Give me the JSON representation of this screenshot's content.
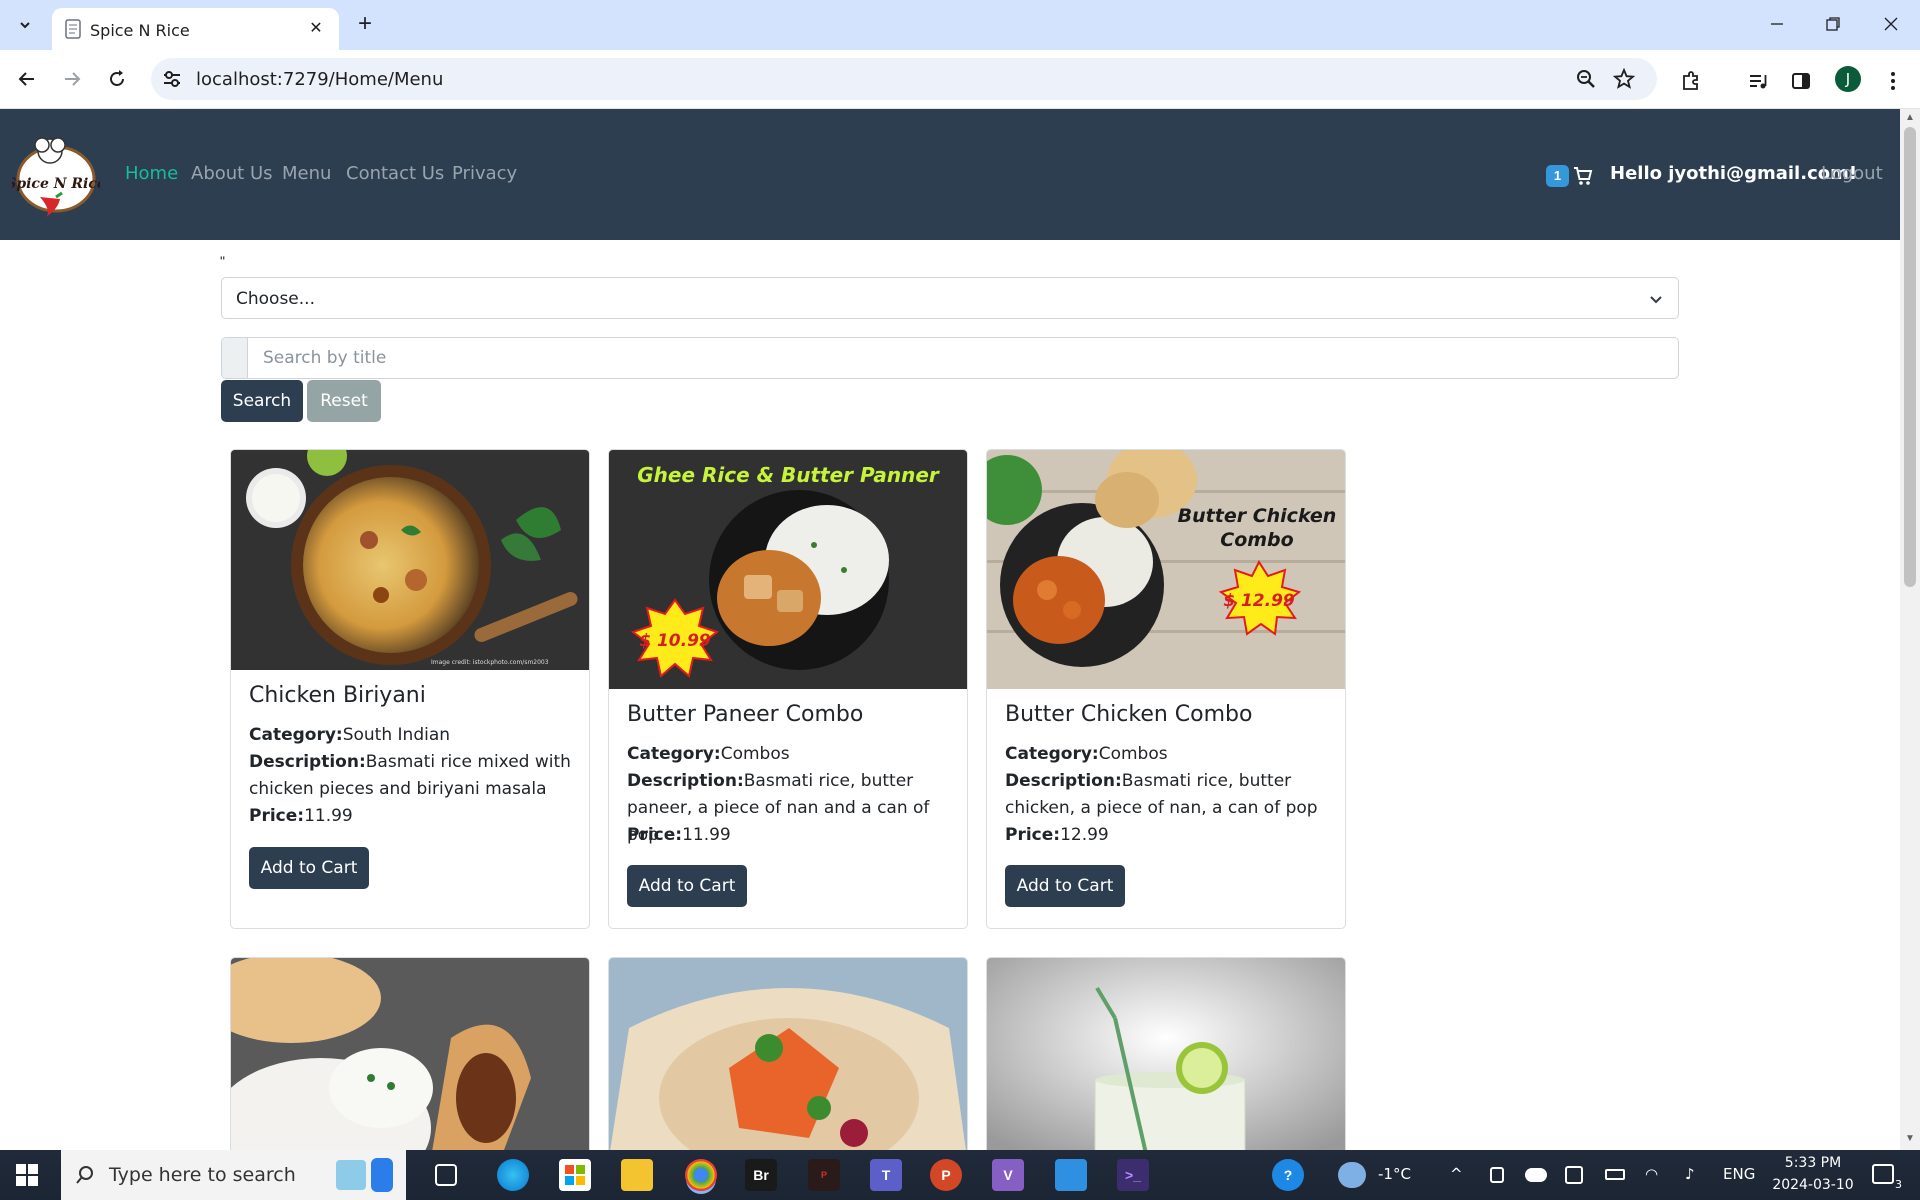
{
  "browser": {
    "tab_title": "Spice N Rice",
    "url": "localhost:7279/Home/Menu",
    "profile_initial": "J"
  },
  "site": {
    "logo_text": "Spice N Rice",
    "nav": [
      "Home",
      "About Us",
      "Menu",
      "Contact Us",
      "Privacy"
    ],
    "active_nav": "Home",
    "cart_count": "1",
    "greeting": "Hello jyothi@gmail.com!",
    "logout_label": "Logout"
  },
  "filters": {
    "stray_text": "\"",
    "category_value": "Choose...",
    "search_placeholder": "Search by title",
    "search_label": "Search",
    "reset_label": "Reset"
  },
  "menu_items": [
    {
      "title": "Chicken Biriyani",
      "category_label": "Category:",
      "category": "South Indian",
      "description_label": "Description:",
      "description": "Basmati rice mixed with chicken pieces and biriyani masala",
      "price_label": "Price:",
      "price": "11.99",
      "button": "Add to Cart",
      "image_caption": "Image credit: istockphoto.com/sm2003"
    },
    {
      "title": "Butter Paneer Combo",
      "category_label": "Category:",
      "category": "Combos",
      "description_label": "Description:",
      "description": "Basmati rice, butter paneer, a piece of nan and a can of pop",
      "price_label": "Price:",
      "price": "11.99",
      "button": "Add to Cart",
      "image_heading": "Ghee Rice & Butter Panner",
      "image_price": "$ 10.99"
    },
    {
      "title": "Butter Chicken Combo",
      "category_label": "Category:",
      "category": "Combos",
      "description_label": "Description:",
      "description": "Basmati rice, butter chicken, a piece of nan, a can of pop",
      "price_label": "Price:",
      "price": "12.99",
      "button": "Add to Cart",
      "image_heading_line1": "Butter Chicken",
      "image_heading_line2": "Combo",
      "image_price": "$ 12.99"
    }
  ],
  "taskbar": {
    "search_placeholder": "Type here to search",
    "weather": "-1°C",
    "language": "ENG",
    "time": "5:33 PM",
    "date": "2024-03-10",
    "notification_count": "3"
  },
  "colors": {
    "navbar": "#2c3e50",
    "active_link": "#1abc9c",
    "cart_badge": "#3498db",
    "reset_button": "#95a5a6"
  }
}
